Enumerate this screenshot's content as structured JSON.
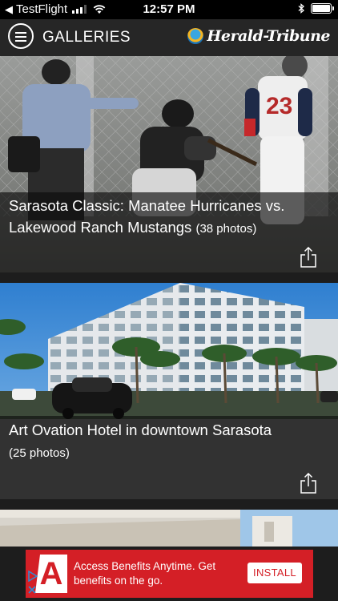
{
  "status_bar": {
    "back_app": "TestFlight",
    "time": "12:57 PM"
  },
  "header": {
    "title": "GALLERIES",
    "brand": "Herald-Tribune",
    "brand_colors": {
      "sun": "#f6b521",
      "sky": "#3aa6e0"
    }
  },
  "galleries": [
    {
      "title": "Sarasota Classic: Manatee Hurricanes vs. Lakewood Ranch Mustangs",
      "count": "(38 photos)"
    },
    {
      "title": "Art Ovation Hotel in downtown Sarasota",
      "count": "(25 photos)"
    },
    {
      "title": "",
      "count": ""
    }
  ],
  "ad": {
    "logo_letter": "A",
    "text": "Access Benefits Anytime. Get benefits on the go.",
    "button_label": "INSTALL",
    "color": "#d41f26"
  },
  "icons": {
    "menu": "menu-icon",
    "share": "share-icon",
    "wifi": "wifi-icon",
    "bluetooth": "bluetooth-icon",
    "battery": "battery-icon",
    "ad_choices": "ad-choices-icon"
  }
}
